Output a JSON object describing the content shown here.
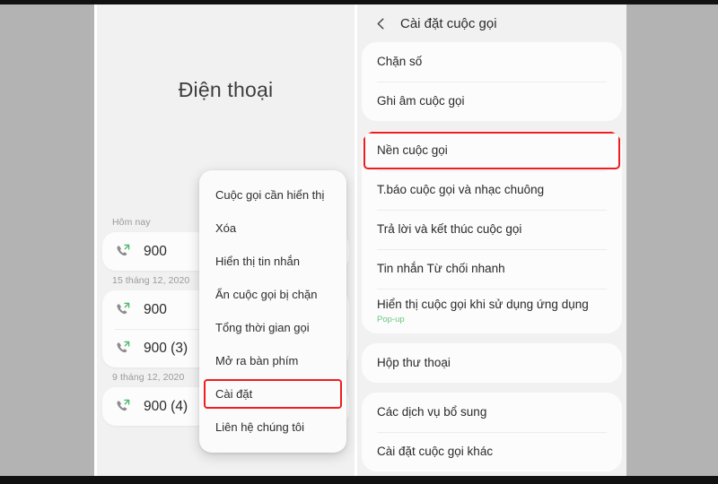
{
  "phone_app": {
    "title": "Điện thoại",
    "call_log": [
      {
        "date_label": "Hôm nay",
        "entries": [
          {
            "number": "900",
            "icon": "outgoing-call-icon"
          }
        ]
      },
      {
        "date_label": "15 tháng 12, 2020",
        "entries": [
          {
            "number": "900",
            "icon": "outgoing-call-icon"
          },
          {
            "number": "900 (3)",
            "icon": "outgoing-call-icon"
          }
        ]
      },
      {
        "date_label": "9 tháng 12, 2020",
        "entries": [
          {
            "number": "900 (4)",
            "icon": "outgoing-call-icon"
          }
        ]
      }
    ]
  },
  "overflow_menu": {
    "items": [
      {
        "label": "Cuộc gọi cần hiển thị",
        "highlighted": false
      },
      {
        "label": "Xóa",
        "highlighted": false
      },
      {
        "label": "Hiển thị tin nhắn",
        "highlighted": false
      },
      {
        "label": "Ẩn cuộc gọi bị chặn",
        "highlighted": false
      },
      {
        "label": "Tổng thời gian gọi",
        "highlighted": false
      },
      {
        "label": "Mở ra bàn phím",
        "highlighted": false
      },
      {
        "label": "Cài đặt",
        "highlighted": true
      },
      {
        "label": "Liên hệ chúng tôi",
        "highlighted": false
      }
    ]
  },
  "call_settings": {
    "back_icon": "chevron-left-icon",
    "header_title": "Cài đặt cuộc gọi",
    "groups": [
      {
        "rows": [
          {
            "label": "Chặn số",
            "sub": "",
            "highlighted": false
          },
          {
            "label": "Ghi âm cuộc gọi",
            "sub": "",
            "highlighted": false
          }
        ]
      },
      {
        "rows": [
          {
            "label": "Nền cuộc gọi",
            "sub": "",
            "highlighted": true
          },
          {
            "label": "T.báo cuộc gọi và nhạc chuông",
            "sub": "",
            "highlighted": false
          },
          {
            "label": "Trả lời và kết thúc cuộc gọi",
            "sub": "",
            "highlighted": false
          },
          {
            "label": "Tin nhắn Từ chối nhanh",
            "sub": "",
            "highlighted": false
          },
          {
            "label": "Hiển thị cuộc gọi khi sử dụng ứng dụng",
            "sub": "Pop-up",
            "highlighted": false
          }
        ]
      },
      {
        "rows": [
          {
            "label": "Hộp thư thoại",
            "sub": "",
            "highlighted": false
          }
        ]
      },
      {
        "rows": [
          {
            "label": "Các dịch vụ bổ sung",
            "sub": "",
            "highlighted": false
          },
          {
            "label": "Cài đặt cuộc gọi khác",
            "sub": "",
            "highlighted": false
          }
        ]
      }
    ]
  },
  "colors": {
    "highlight_red": "#ef1d1d",
    "accent_green": "#6cc47f",
    "panel_bg": "#f1f1f1",
    "card_bg": "#fcfcfc",
    "letterbox": "#b3b3b3"
  }
}
